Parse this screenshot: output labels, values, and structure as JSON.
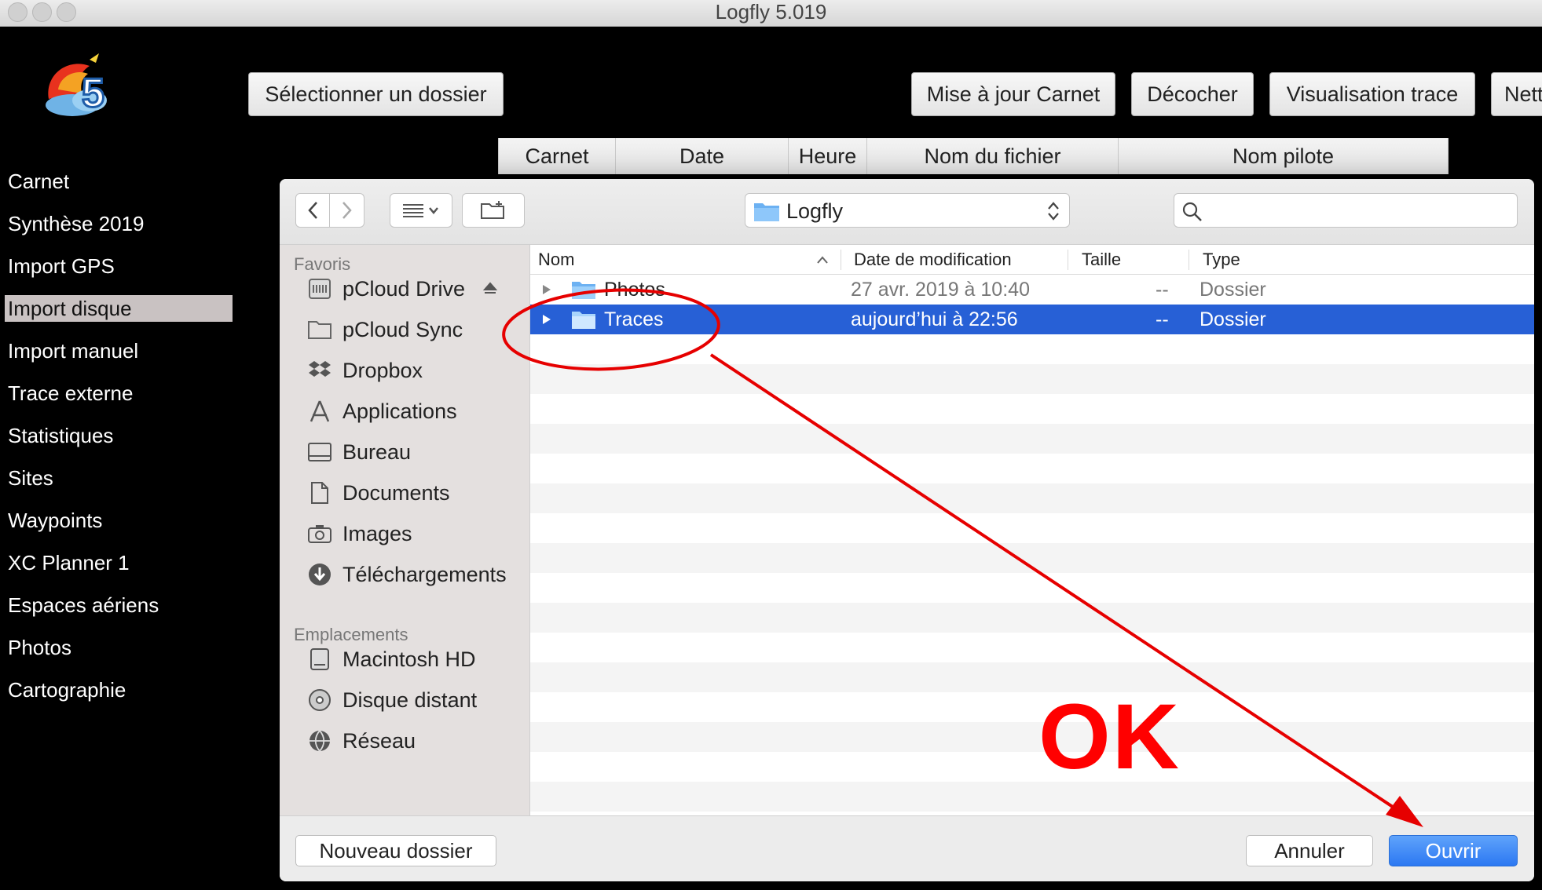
{
  "window": {
    "title": "Logfly 5.019"
  },
  "sidebar": {
    "items": [
      {
        "label": "Carnet"
      },
      {
        "label": "Synthèse  2019"
      },
      {
        "label": "Import GPS"
      },
      {
        "label": "Import disque",
        "active": true
      },
      {
        "label": "Import manuel"
      },
      {
        "label": "Trace externe"
      },
      {
        "label": "Statistiques"
      },
      {
        "label": "Sites"
      },
      {
        "label": "Waypoints"
      },
      {
        "label": "XC Planner 1"
      },
      {
        "label": "Espaces aériens"
      },
      {
        "label": "Photos"
      },
      {
        "label": "Cartographie"
      }
    ]
  },
  "toolbar": {
    "select_folder": "Sélectionner un dossier",
    "update_logbook": "Mise à jour Carnet",
    "uncheck": "Décocher",
    "view_track": "Visualisation trace",
    "clean": "Nett"
  },
  "table": {
    "columns": [
      "Carnet",
      "Date",
      "Heure",
      "Nom du fichier",
      "Nom pilote"
    ]
  },
  "dialog": {
    "path": "Logfly",
    "search_placeholder": "",
    "favorites_title": "Favoris",
    "favorites": [
      {
        "label": "pCloud Drive",
        "icon": "pcloud-drive-icon"
      },
      {
        "label": "pCloud Sync",
        "icon": "folder-icon"
      },
      {
        "label": "Dropbox",
        "icon": "dropbox-icon"
      },
      {
        "label": "Applications",
        "icon": "applications-icon"
      },
      {
        "label": "Bureau",
        "icon": "desktop-icon"
      },
      {
        "label": "Documents",
        "icon": "documents-icon"
      },
      {
        "label": "Images",
        "icon": "camera-icon"
      },
      {
        "label": "Téléchargements",
        "icon": "download-icon"
      }
    ],
    "locations_title": "Emplacements",
    "locations": [
      {
        "label": "Macintosh HD",
        "icon": "hard-drive-icon"
      },
      {
        "label": "Disque distant",
        "icon": "disc-icon"
      },
      {
        "label": "Réseau",
        "icon": "network-icon"
      }
    ],
    "columns": {
      "name": "Nom",
      "modified": "Date de modification",
      "size": "Taille",
      "type": "Type"
    },
    "rows": [
      {
        "name": "Photos",
        "modified": "27 avr. 2019 à 10:40",
        "size": "--",
        "type": "Dossier",
        "selected": false
      },
      {
        "name": "Traces",
        "modified": "aujourd’hui à 22:56",
        "size": "--",
        "type": "Dossier",
        "selected": true
      }
    ],
    "new_folder": "Nouveau dossier",
    "cancel": "Annuler",
    "open": "Ouvrir"
  },
  "annotation": {
    "text": "OK",
    "color": "#ff0000"
  },
  "colors": {
    "selection": "#2760d6",
    "primary_button": "#2c78f2",
    "sidebar_active": "#c9c2c2"
  }
}
